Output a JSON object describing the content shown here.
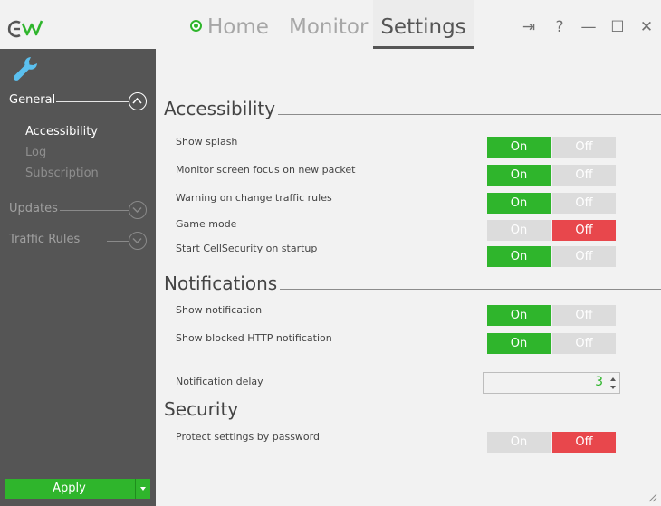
{
  "header": {
    "nav": {
      "home": "Home",
      "monitor": "Monitor",
      "settings": "Settings"
    },
    "window_buttons": {
      "pin": "⇥",
      "help": "?",
      "minimize": "—",
      "maximize": "☐",
      "close": "✕"
    }
  },
  "sidebar": {
    "sections": {
      "general": "General",
      "updates": "Updates",
      "traffic_rules": "Traffic Rules"
    },
    "general_items": {
      "accessibility": "Accessibility",
      "log": "Log",
      "subscription": "Subscription"
    },
    "apply_label": "Apply"
  },
  "main": {
    "accessibility": {
      "heading": "Accessibility",
      "rows": [
        {
          "label": "Show splash",
          "on": "On",
          "off": "Off",
          "state": "on"
        },
        {
          "label": "Monitor screen focus on new packet",
          "on": "On",
          "off": "Off",
          "state": "on"
        },
        {
          "label": "Warning on change traffic rules",
          "on": "On",
          "off": "Off",
          "state": "on"
        },
        {
          "label": "Game mode",
          "on": "On",
          "off": "Off",
          "state": "off"
        },
        {
          "label": "Start CellSecurity on startup",
          "on": "On",
          "off": "Off",
          "state": "on"
        }
      ]
    },
    "notifications": {
      "heading": "Notifications",
      "rows": [
        {
          "label": "Show notification",
          "on": "On",
          "off": "Off",
          "state": "on"
        },
        {
          "label": "Show blocked HTTP notification",
          "on": "On",
          "off": "Off",
          "state": "on"
        }
      ],
      "delay_label": "Notification delay",
      "delay_value": "3"
    },
    "security": {
      "heading": "Security",
      "rows": [
        {
          "label": "Protect settings by password",
          "on": "On",
          "off": "Off",
          "state": "off"
        }
      ]
    }
  },
  "colors": {
    "accent_green": "#2fb52c",
    "off_red": "#e8474c",
    "sidebar_bg": "#555555"
  }
}
